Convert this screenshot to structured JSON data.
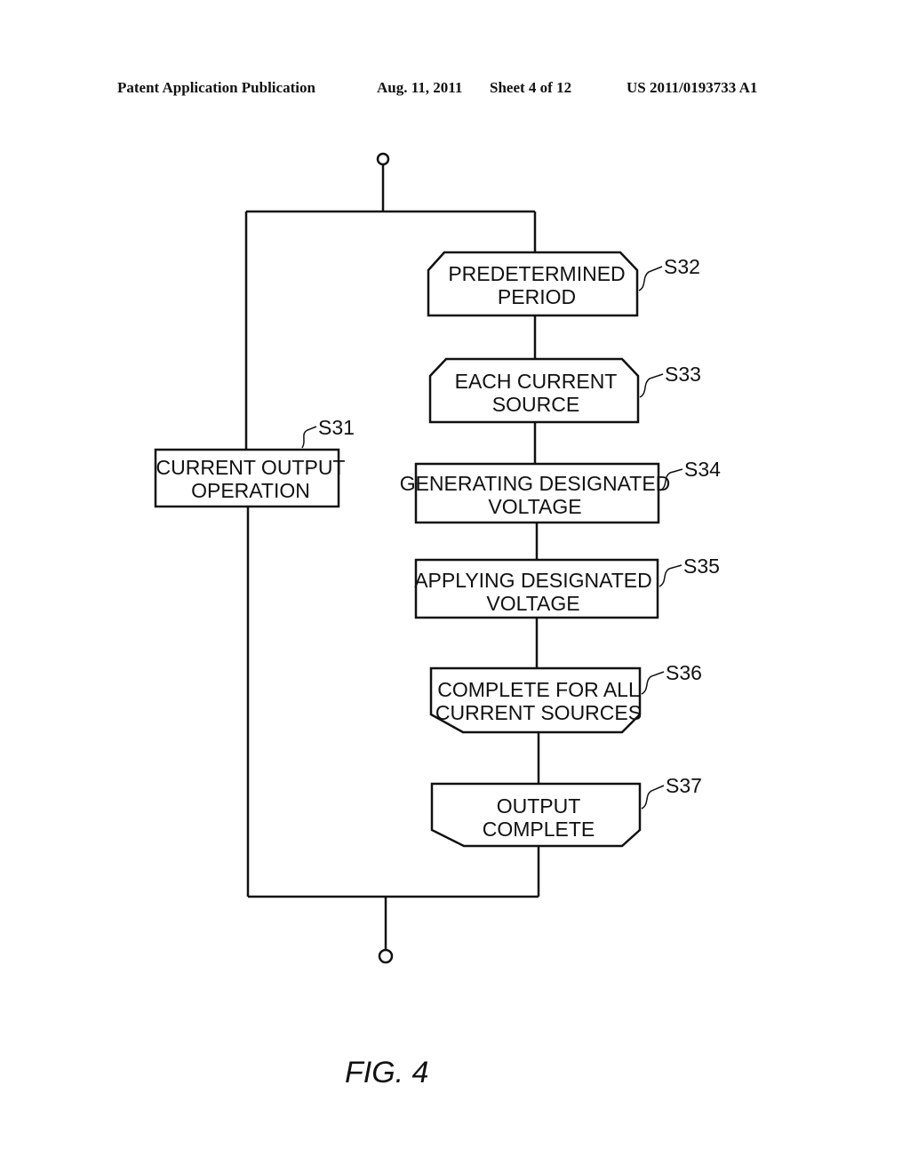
{
  "header": {
    "publication": "Patent Application Publication",
    "date": "Aug. 11, 2011",
    "sheet": "Sheet 4 of 12",
    "number": "US 2011/0193733 A1"
  },
  "figure_label": "FIG. 4",
  "steps": {
    "s31": {
      "id": "S31",
      "shape": "process",
      "lines": [
        "CURRENT OUTPUT",
        "OPERATION"
      ]
    },
    "s32": {
      "id": "S32",
      "shape": "loop-start",
      "lines": [
        "PREDETERMINED",
        "PERIOD"
      ]
    },
    "s33": {
      "id": "S33",
      "shape": "loop-start",
      "lines": [
        "EACH CURRENT",
        "SOURCE"
      ]
    },
    "s34": {
      "id": "S34",
      "shape": "process",
      "lines": [
        "GENERATING DESIGNATED",
        "VOLTAGE"
      ]
    },
    "s35": {
      "id": "S35",
      "shape": "process",
      "lines": [
        "APPLYING DESIGNATED",
        "VOLTAGE"
      ]
    },
    "s36": {
      "id": "S36",
      "shape": "loop-end",
      "lines": [
        "COMPLETE FOR ALL",
        "CURRENT SOURCES"
      ]
    },
    "s37": {
      "id": "S37",
      "shape": "loop-end",
      "lines": [
        "OUTPUT",
        "COMPLETE"
      ]
    }
  }
}
